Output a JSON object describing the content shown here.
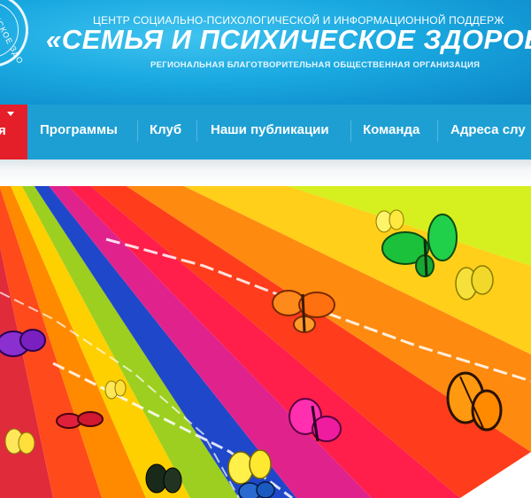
{
  "header": {
    "top_line": "ЦЕНТР СОЦИАЛЬНО-ПСИХОЛОГИЧЕСКОЙ И ИНФОРМАЦИОННОЙ ПОДДЕРЖ",
    "title": "«СЕМЬЯ И ПСИХИЧЕСКОЕ ЗДОРОВ",
    "subtitle": "РЕГИОНАЛЬНАЯ БЛАГОТВОРИТЕЛЬНАЯ ОБЩЕСТВЕННАЯ ОРГАНИЗАЦИЯ",
    "logo_text": "ИЧЕСКОЕ ЗДО"
  },
  "nav": {
    "active_label": "я",
    "items": [
      "Программы",
      "Клуб",
      "Наши публикации",
      "Команда",
      "Адреса слу"
    ]
  },
  "colors": {
    "header_blue": "#1aa9e1",
    "nav_blue": "#1d9fd4",
    "active_red": "#e51f2a"
  },
  "banner": {
    "image": "color-fan-with-butterflies"
  }
}
